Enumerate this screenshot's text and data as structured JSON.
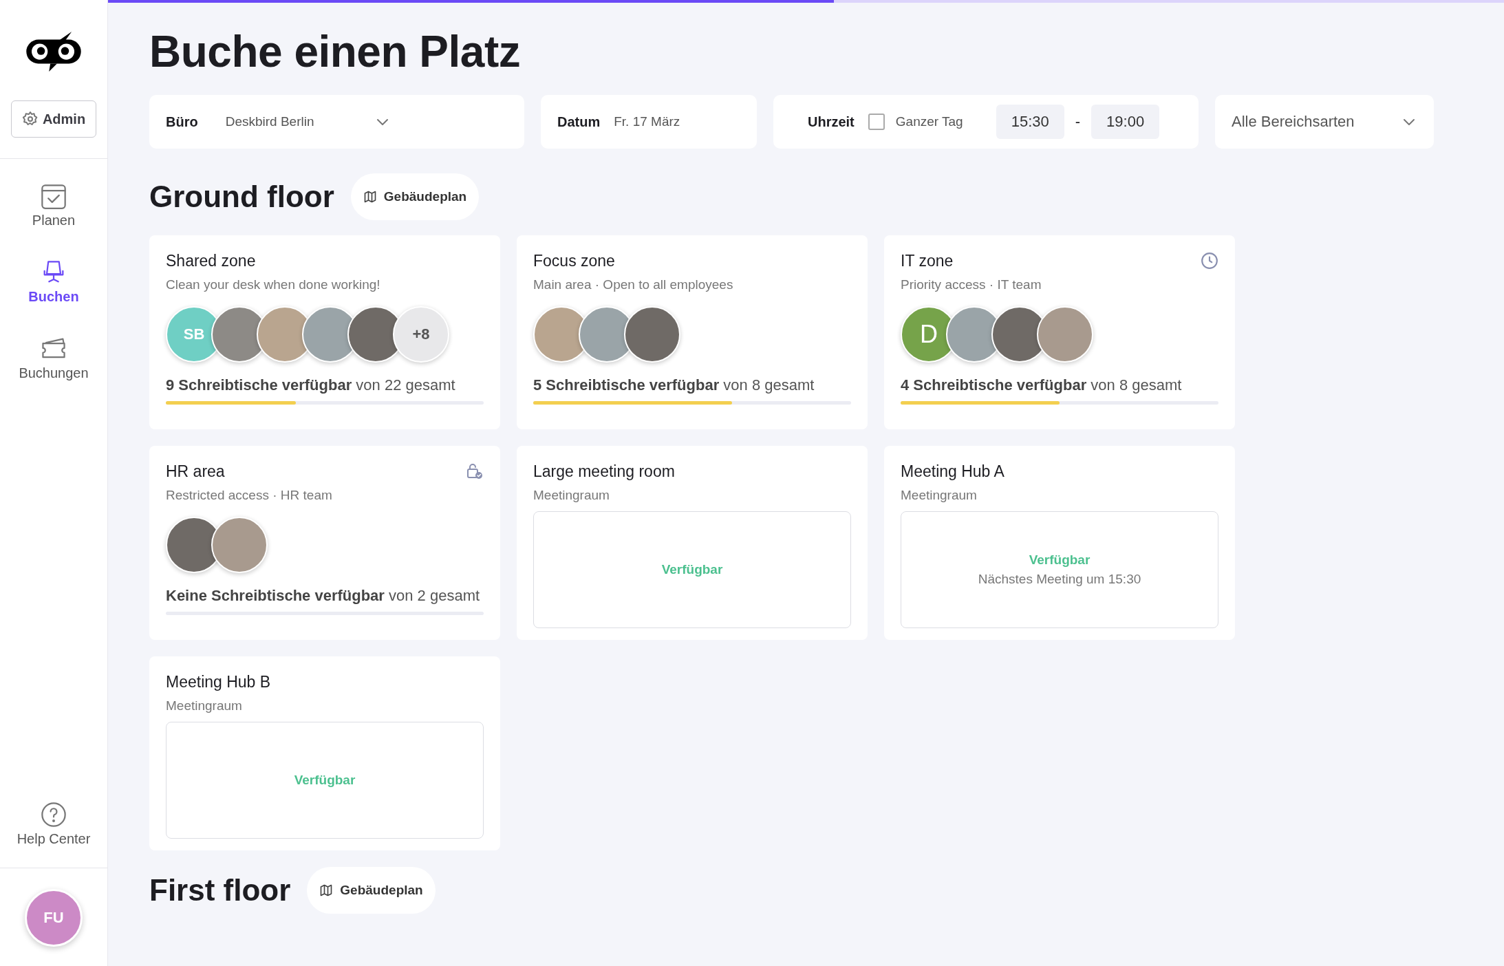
{
  "sidebar": {
    "admin_button": "Admin",
    "nav": [
      {
        "label": "Planen",
        "kind": "calendar",
        "selected": false
      },
      {
        "label": "Buchen",
        "kind": "chair",
        "selected": true
      },
      {
        "label": "Buchungen",
        "kind": "ticket",
        "selected": false
      }
    ],
    "help": "Help Center",
    "user_initials": "FU"
  },
  "progress": {
    "level": 0.52
  },
  "title": "Buche einen Platz",
  "filters": {
    "office": {
      "label": "Büro",
      "value": "Deskbird Berlin"
    },
    "date": {
      "label": "Datum",
      "value": "Fr. 17 März"
    },
    "time": {
      "label": "Uhrzeit",
      "all_day": {
        "label": "Ganzer Tag",
        "checked": false
      },
      "start": "15:30",
      "separator": "-",
      "end": "19:00"
    },
    "area_type": {
      "value": "Alle Bereichsarten"
    }
  },
  "floors": [
    {
      "name": "Ground floor",
      "plan_button": "Gebäudeplan",
      "areas": [
        {
          "kind": "zone",
          "title": "Shared zone",
          "subtitle": "Clean your desk when done working!",
          "time_limited": false,
          "restricted": false,
          "avatars": [
            {
              "kind": "initials",
              "text": "SB",
              "color": "#6fcfc4"
            },
            {
              "kind": "photo"
            },
            {
              "kind": "photo"
            },
            {
              "kind": "photo"
            },
            {
              "kind": "photo"
            },
            {
              "kind": "more",
              "text": "+8"
            }
          ],
          "availability": "**9 Schreibtische verfügbar** von 22 gesamt",
          "level": 0.41
        },
        {
          "kind": "zone",
          "title": "Focus zone",
          "subtitle": "Main area · Open to all employees",
          "time_limited": false,
          "restricted": false,
          "avatars": [
            {
              "kind": "photo"
            },
            {
              "kind": "photo"
            },
            {
              "kind": "photo"
            }
          ],
          "availability": "**5 Schreibtische verfügbar** von 8 gesamt",
          "level": 0.625
        },
        {
          "kind": "zone",
          "title": "IT zone",
          "subtitle": "Priority access · IT team",
          "time_limited": true,
          "restricted": false,
          "avatars": [
            {
              "kind": "initials",
              "text": "D",
              "color": "#76a34a"
            },
            {
              "kind": "photo"
            },
            {
              "kind": "photo"
            },
            {
              "kind": "photo"
            }
          ],
          "availability": "**4 Schreibtische verfügbar** von 8 gesamt",
          "level": 0.5
        },
        {
          "kind": "zone",
          "title": "HR area",
          "subtitle": "Restricted access · HR team",
          "time_limited": false,
          "restricted": true,
          "avatars": [
            {
              "kind": "photo"
            },
            {
              "kind": "photo"
            }
          ],
          "availability": "**Keine Schreibtische verfügbar** von 2 gesamt",
          "level": 0
        },
        {
          "kind": "room",
          "title": "Large meeting room",
          "subtitle": "Meetingraum",
          "status": "Verfügbar"
        },
        {
          "kind": "room",
          "title": "Meeting Hub A",
          "subtitle": "Meetingraum",
          "status": "Verfügbar",
          "note": "Nächstes Meeting um 15:30"
        },
        {
          "kind": "room",
          "title": "Meeting Hub B",
          "subtitle": "Meetingraum",
          "status": "Verfügbar"
        }
      ]
    },
    {
      "name": "First floor",
      "plan_button": "Gebäudeplan"
    }
  ]
}
